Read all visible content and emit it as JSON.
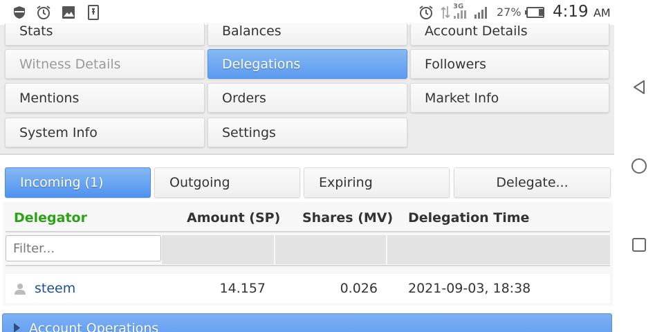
{
  "status_bar": {
    "icons_left": [
      "shield-icon",
      "alarm-icon",
      "image-icon",
      "sim-icon"
    ],
    "icons_right": [
      "alarm-icon",
      "data-arrows-icon",
      "signal-3g-icon",
      "signal-icon",
      "battery-icon"
    ],
    "network_label": "3G",
    "battery": "27%",
    "time": "4:19",
    "ampm": "AM"
  },
  "menu": {
    "items": [
      {
        "label": "Stats",
        "state": "normal"
      },
      {
        "label": "Balances",
        "state": "normal"
      },
      {
        "label": "Account Details",
        "state": "normal"
      },
      {
        "label": "Witness Details",
        "state": "disabled"
      },
      {
        "label": "Delegations",
        "state": "active"
      },
      {
        "label": "Followers",
        "state": "normal"
      },
      {
        "label": "Mentions",
        "state": "normal"
      },
      {
        "label": "Orders",
        "state": "normal"
      },
      {
        "label": "Market Info",
        "state": "normal"
      },
      {
        "label": "System Info",
        "state": "normal"
      },
      {
        "label": "Settings",
        "state": "normal"
      }
    ]
  },
  "tabs": [
    {
      "label": "Incoming (1)",
      "active": true
    },
    {
      "label": "Outgoing",
      "active": false
    },
    {
      "label": "Expiring",
      "active": false
    },
    {
      "label": "Delegate...",
      "active": false
    }
  ],
  "table": {
    "headers": [
      "Delegator",
      "Amount (SP)",
      "Shares (MV)",
      "Delegation Time"
    ],
    "filter_placeholder": "Filter...",
    "rows": [
      {
        "delegator": "steem",
        "amount": "14.157",
        "shares": "0.026",
        "time": "2021-09-03, 18:38"
      }
    ]
  },
  "account_operations": {
    "label": "Account Operations"
  },
  "nav": {
    "icons": [
      "back-icon",
      "home-icon",
      "recents-icon"
    ]
  },
  "colors": {
    "accent_blue": "#5b9bf1",
    "delegator_green": "#2aa315",
    "link_blue": "#1b4f9c"
  }
}
